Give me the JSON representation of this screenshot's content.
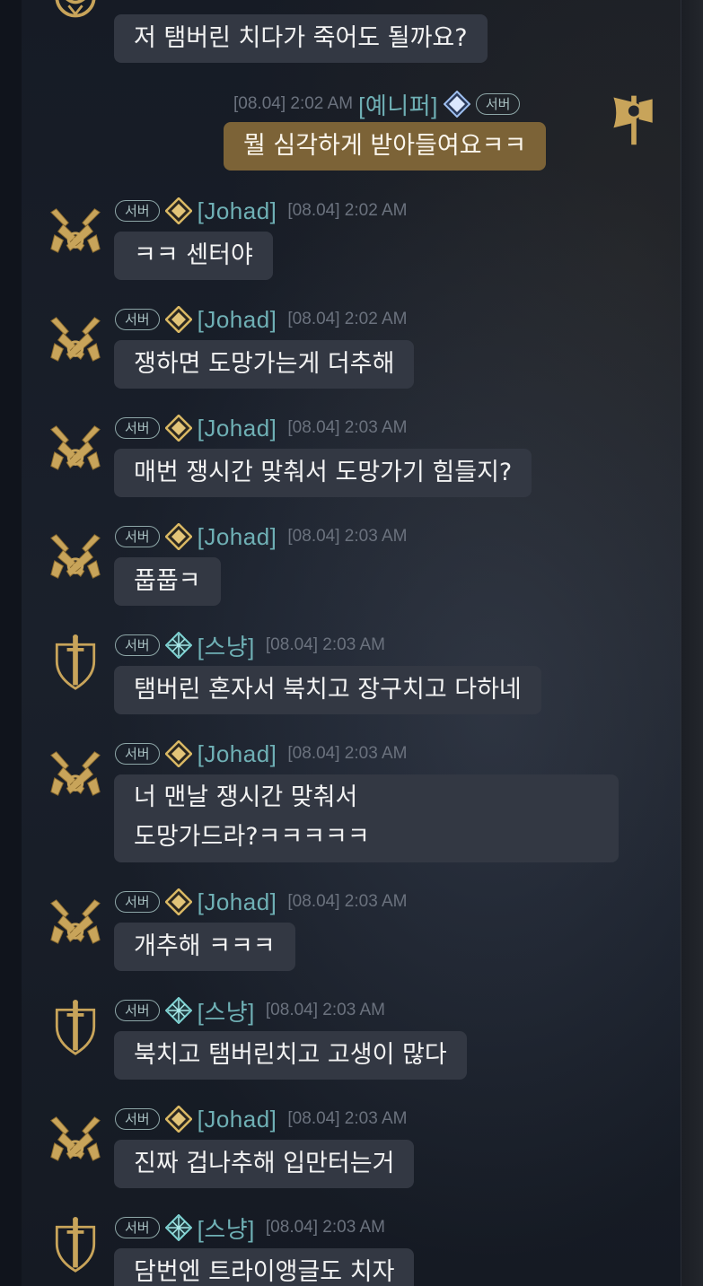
{
  "server_badge": "서버",
  "messages": [
    {
      "name": "",
      "time": "",
      "text": "저 탬버린 치다가 죽어도 될까요?",
      "avatar": "dragon-emblem"
    },
    {
      "name": "[예니퍼]",
      "time": "[08.04] 2:02 AM",
      "text": "뭘 심각하게 받아들여요ㅋㅋ",
      "avatar": "axe-emblem",
      "mine": true
    },
    {
      "name": "[Johad]",
      "time": "[08.04] 2:02 AM",
      "text": "ㅋㅋ 센터야",
      "avatar": "crossed-pistols-emblem"
    },
    {
      "name": "[Johad]",
      "time": "[08.04] 2:02 AM",
      "text": "쟁하면 도망가는게 더추해",
      "avatar": "crossed-pistols-emblem"
    },
    {
      "name": "[Johad]",
      "time": "[08.04] 2:03 AM",
      "text": "매번 쟁시간 맞춰서 도망가기 힘들지?",
      "avatar": "crossed-pistols-emblem"
    },
    {
      "name": "[Johad]",
      "time": "[08.04] 2:03 AM",
      "text": "풉풉ㅋ",
      "avatar": "crossed-pistols-emblem"
    },
    {
      "name": "[스냥]",
      "time": "[08.04] 2:03 AM",
      "text": "탬버린 혼자서 북치고 장구치고 다하네",
      "avatar": "sword-shield-emblem"
    },
    {
      "name": "[Johad]",
      "time": "[08.04] 2:03 AM",
      "text_line1": "너 맨날 쟁시간 맞춰서",
      "text_line2": "도망가드라?ㅋㅋㅋㅋㅋ",
      "avatar": "crossed-pistols-emblem"
    },
    {
      "name": "[Johad]",
      "time": "[08.04] 2:03 AM",
      "text": "개추해 ㅋㅋㅋ",
      "avatar": "crossed-pistols-emblem"
    },
    {
      "name": "[스냥]",
      "time": "[08.04] 2:03 AM",
      "text": "북치고 탬버린치고 고생이 많다",
      "avatar": "sword-shield-emblem"
    },
    {
      "name": "[Johad]",
      "time": "[08.04] 2:03 AM",
      "text": "진짜 겁나추해 입만터는거",
      "avatar": "crossed-pistols-emblem"
    },
    {
      "name": "[스냥]",
      "time": "[08.04] 2:03 AM",
      "text": "담번엔 트라이앵글도 치자",
      "avatar": "sword-shield-emblem"
    }
  ],
  "colors": {
    "background": "#151a24",
    "bubble": "#333843",
    "bubble_mine": "#7c6337",
    "name": "#6fb0b5",
    "time": "#6b727e",
    "emblem_gold": "#c8a45a"
  }
}
